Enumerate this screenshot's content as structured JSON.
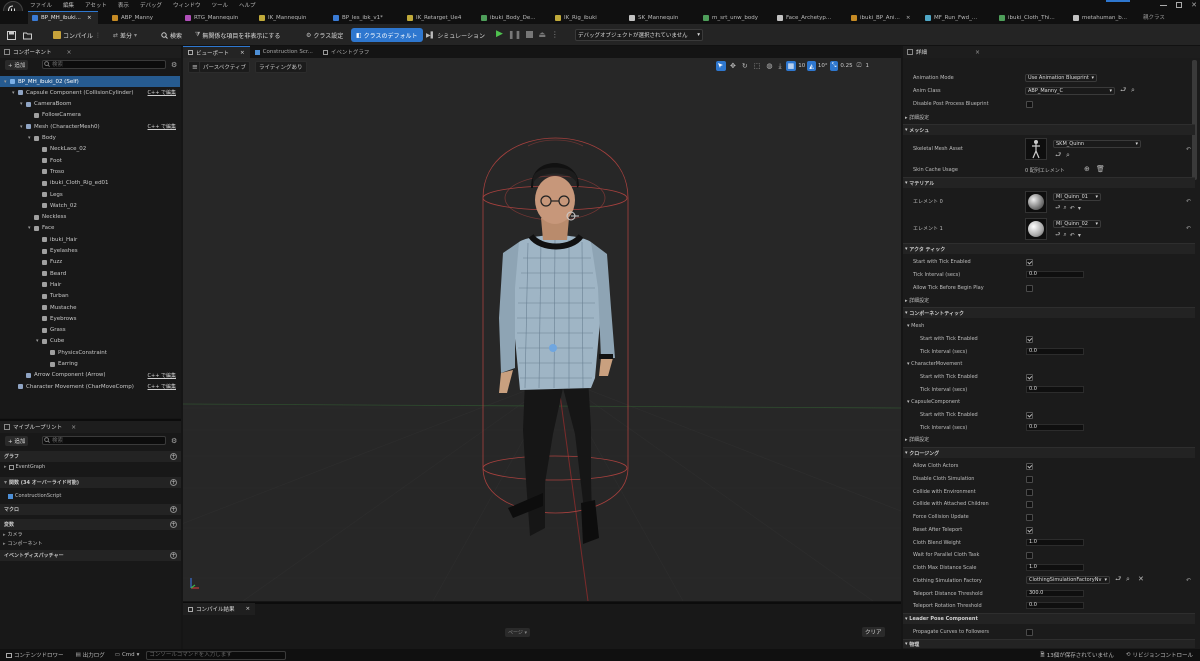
{
  "menu": {
    "items": [
      "ファイル",
      "編集",
      "アセット",
      "表示",
      "デバッグ",
      "ウィンドウ",
      "ツール",
      "ヘルプ"
    ]
  },
  "tabs": [
    {
      "label": "BP_MH_ibuki...",
      "close": "×"
    },
    {
      "label": "ABP_Manny"
    },
    {
      "label": "RTG_Mannequin"
    },
    {
      "label": "IK_Mannequin"
    },
    {
      "label": "BP_les_ibk_v1*"
    },
    {
      "label": "IK_Retarget_Ue4"
    },
    {
      "label": "ibuki_Body_De..."
    },
    {
      "label": "IK_Rig_ibuki"
    },
    {
      "label": "SK_Mannequin"
    },
    {
      "label": "m_srt_unw_body"
    },
    {
      "label": "Face_Archetyp..."
    },
    {
      "label": "ibuki_BP_Ani...",
      "close": "×"
    },
    {
      "label": "MF_Run_Fwd_..."
    },
    {
      "label": "ibuki_Cloth_Thi..."
    },
    {
      "label": "metahuman_b..."
    }
  ],
  "parent_class": "親クラス",
  "toolbar": {
    "compile": "コンパイル",
    "diff": "差分",
    "search": "検索",
    "hide_unrelated": "無関係な項目を非表示にする",
    "class_settings": "クラス設定",
    "class_defaults": "クラスのデフォルト",
    "simulation": "シミュレーション",
    "debug_select": "デバッグオブジェクトが選択されていません"
  },
  "components": {
    "title": "コンポーネント",
    "add": "+ 追加",
    "search_placeholder": "検索",
    "items": [
      {
        "label": "BP_MH_ibuki_02 (Self)",
        "indent": 0,
        "selected": true
      },
      {
        "label": "Capsule Component (CollisionCylinder)",
        "indent": 1,
        "cpp": "C++ で編集"
      },
      {
        "label": "CameraBoom",
        "indent": 2
      },
      {
        "label": "FollowCamera",
        "indent": 3
      },
      {
        "label": "Mesh (CharacterMesh0)",
        "indent": 2,
        "cpp": "C++ で編集"
      },
      {
        "label": "Body",
        "indent": 3
      },
      {
        "label": "NeckLace_02",
        "indent": 4
      },
      {
        "label": "Foot",
        "indent": 4
      },
      {
        "label": "Troso",
        "indent": 4
      },
      {
        "label": "ibuki_Cloth_Rig_ed01",
        "indent": 4
      },
      {
        "label": "Legs",
        "indent": 4
      },
      {
        "label": "Watch_02",
        "indent": 4
      },
      {
        "label": "Neckless",
        "indent": 3
      },
      {
        "label": "Face",
        "indent": 3
      },
      {
        "label": "ibuki_Hair",
        "indent": 4
      },
      {
        "label": "Eyelashes",
        "indent": 4
      },
      {
        "label": "Fuzz",
        "indent": 4
      },
      {
        "label": "Beard",
        "indent": 4
      },
      {
        "label": "Hair",
        "indent": 4
      },
      {
        "label": "Turban",
        "indent": 4
      },
      {
        "label": "Mustache",
        "indent": 4
      },
      {
        "label": "Eyebrows",
        "indent": 4
      },
      {
        "label": "Grass",
        "indent": 4
      },
      {
        "label": "Cube",
        "indent": 4
      },
      {
        "label": "PhysicsConstraint",
        "indent": 5
      },
      {
        "label": "Earring",
        "indent": 5
      },
      {
        "label": "Arrow Component (Arrow)",
        "indent": 2,
        "cpp": "C++ で編集"
      },
      {
        "label": "Character Movement (CharMoveComp)",
        "indent": 1,
        "cpp": "C++ で編集"
      }
    ]
  },
  "myblueprint": {
    "title": "マイブループリント",
    "add": "+ 追加",
    "search_placeholder": "検索",
    "graph": "グラフ",
    "eventgraph": "EventGraph",
    "functions": "関数 (34 オーバーライド可能)",
    "construction": "ConstructionScript",
    "macro": "マクロ",
    "variables": "変数",
    "camera": "カメラ",
    "component": "コンポーネント",
    "dispatcher": "イベントディスパッチャー"
  },
  "viewport": {
    "tabs": [
      "ビューポート",
      "Construction Scr...",
      "イベントグラフ"
    ],
    "perspective": "パースペクティブ",
    "lighting": "ライティングあり",
    "grid": "10",
    "angle": "10°",
    "scale": "0.25",
    "cam": "1"
  },
  "compile_results": {
    "title": "コンパイル結果",
    "page": "ページ ▾",
    "clear": "クリア"
  },
  "details": {
    "title": "詳細",
    "rows": [
      {
        "label": "Animation Mode",
        "value": "Use Animation Blueprint",
        "type": "dd"
      },
      {
        "label": "Anim Class",
        "value": "ABP_Manny_C",
        "type": "dd2"
      },
      {
        "label": "Disable Post Process Blueprint",
        "type": "cb"
      }
    ],
    "section_detail": "詳細設定",
    "mesh_section": "メッシュ",
    "skeletal_label": "Skeletal Mesh Asset",
    "skeletal_value": "SKM_Quinn",
    "skin_cache_label": "Skin Cache Usage",
    "skin_cache_value": "0 配列エレメント",
    "material_section": "マテリアル",
    "element0": "エレメント 0",
    "element0_value": "MI_Quinn_01",
    "element1": "エレメント 1",
    "element1_value": "MI_Quinn_02",
    "activity_section": "アクタ ティック",
    "start_tick": "Start with Tick Enabled",
    "tick_interval": "Tick Interval (secs)",
    "tick_value": "0.0",
    "allow_tick": "Allow Tick Before Begin Play",
    "detail2": "詳細設定",
    "component_tick": "コンポーネントティック",
    "mesh_sub": "Mesh",
    "charmove_sub": "CharacterMovement",
    "capsule_sub": "CapsuleComponent",
    "detail3": "詳細設定",
    "cloth_section": "クロージング",
    "allow_cloth": "Allow Cloth Actors",
    "disable_cloth": "Disable Cloth Simulation",
    "collide_env": "Collide with Environment",
    "collide_child": "Collide with Attached Children",
    "force_collision": "Force Collision Update",
    "reset_teleport": "Reset After Teleport",
    "cloth_blend": "Cloth Blend Weight",
    "cloth_blend_value": "1.0",
    "wait_parallel": "Wait for Parallel Cloth Task",
    "max_distance": "Cloth Max Distance Scale",
    "max_distance_value": "1.0",
    "factory": "Clothing Simulation Factory",
    "factory_value": "ClothingSimulationFactoryNv",
    "teleport_dist": "Teleport Distance Threshold",
    "teleport_dist_value": "300.0",
    "teleport_rot": "Teleport Rotation Threshold",
    "teleport_rot_value": "0.0",
    "leader_section": "Leader Pose Component",
    "propagate": "Propagate Curves to Followers",
    "physics_section": "物理"
  },
  "statusbar": {
    "content_drawer": "コンテンツドロワー",
    "output_log": "出力ログ",
    "cmd": "Cmd",
    "console_placeholder": "コンソールコマンドを入力します",
    "unsaved": "13個が保存されていません",
    "revision": "リビジョンコントロール"
  },
  "colors": {
    "accent": "#2e77cf",
    "selection": "#265b90",
    "bg": "#151515"
  }
}
